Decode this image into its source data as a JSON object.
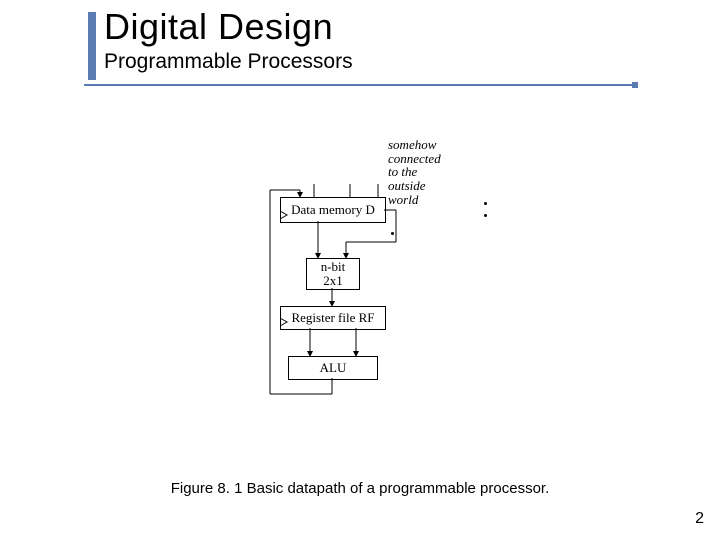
{
  "title": "Digital Design",
  "subtitle": "Programmable Processors",
  "caption": "Figure 8. 1 Basic datapath of a programmable processor.",
  "page_number": "2",
  "diagram": {
    "annotation": "somehow\nconnected\nto the\noutside\nworld",
    "data_memory": "Data memory D",
    "mux_top": "n-bit",
    "mux_bottom": "2x1",
    "register_file": "Register file RF",
    "alu": "ALU"
  }
}
